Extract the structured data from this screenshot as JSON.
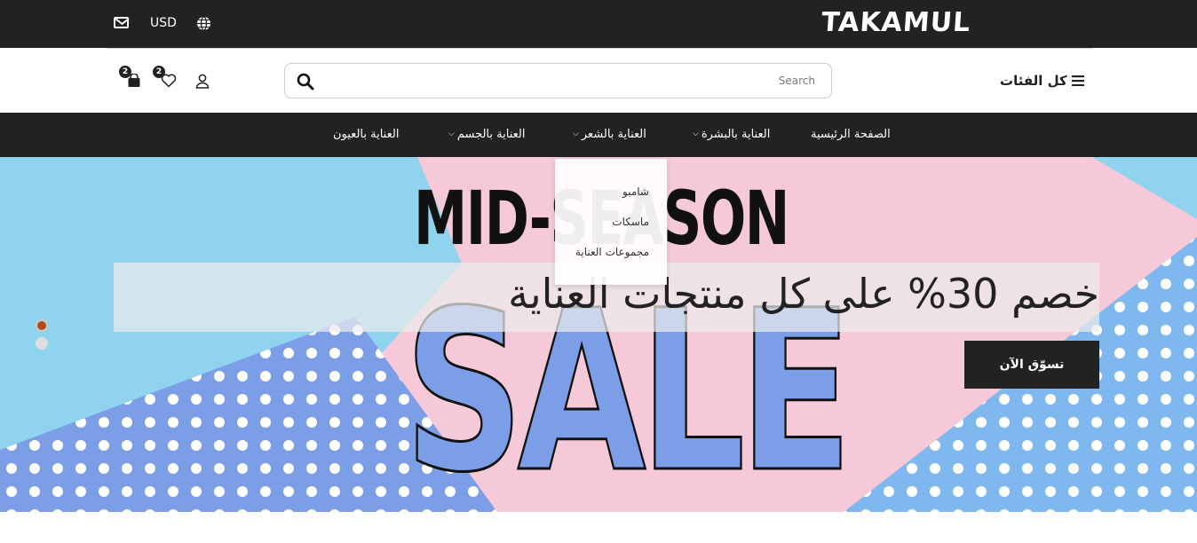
{
  "topbar": {
    "logo": "TAKAMUL",
    "currency": "USD"
  },
  "header": {
    "all_categories": "كل الفئات",
    "search_placeholder": "Search",
    "cart_count": "2",
    "wishlist_count": "2"
  },
  "nav": {
    "items": [
      {
        "label": "الصفحة الرئيسية",
        "has_dropdown": false
      },
      {
        "label": "العناية بالبشرة",
        "has_dropdown": true
      },
      {
        "label": "العناية بالشعر",
        "has_dropdown": true
      },
      {
        "label": "العناية بالجسم",
        "has_dropdown": true
      },
      {
        "label": "العناية بالعيون",
        "has_dropdown": false
      }
    ]
  },
  "dropdown": {
    "items": [
      "شامبو",
      "ماسكات",
      "مجموعات العناية"
    ]
  },
  "hero": {
    "title": "MID-SEASON",
    "big": "SALE",
    "headline": "خصم 30% على كل منتجات العناية",
    "cta": "تسوّق الآن",
    "active_slide": 1,
    "slide_count": 2
  },
  "colors": {
    "dark": "#222222",
    "pink": "#f6c9d9",
    "cyan": "#8fd3ee",
    "blue": "#7b9ee6",
    "sky": "#7fb8ee",
    "active_dot": "#b34a1e"
  },
  "icons": {
    "mail": "mail-icon",
    "globe": "globe-icon",
    "cart": "shopping-bag-icon",
    "wishlist": "heart-icon",
    "account": "user-icon",
    "search": "search-icon",
    "menu": "hamburger-icon",
    "chevron": "chevron-down-icon"
  }
}
